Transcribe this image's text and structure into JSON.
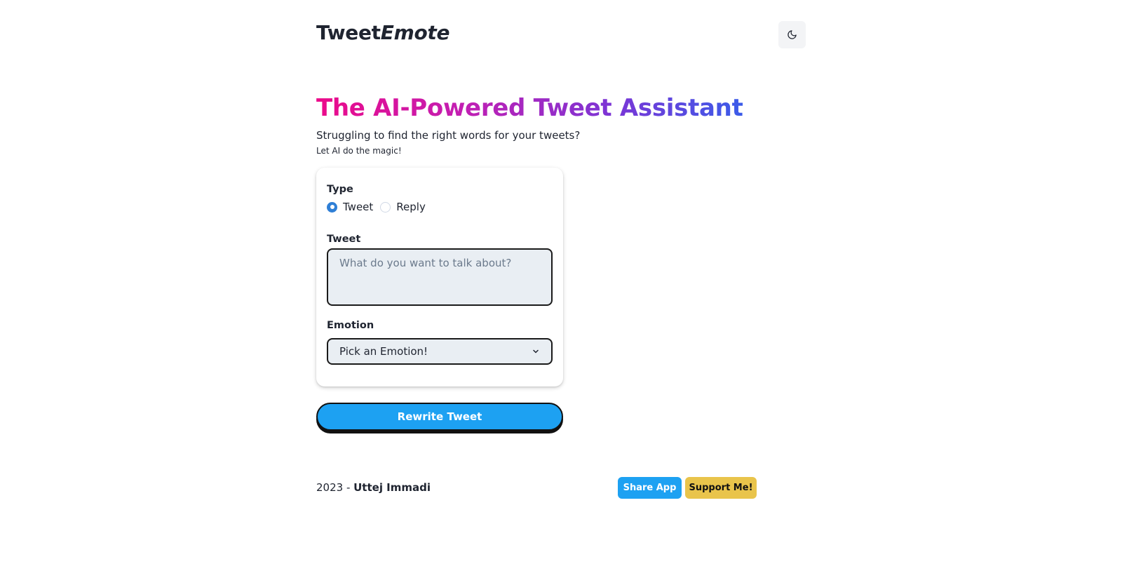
{
  "header": {
    "title_plain": "Tweet",
    "title_emphasis": "Emote",
    "theme_toggle_icon": "moon-icon"
  },
  "hero": {
    "headline": "The AI-Powered Tweet Assistant",
    "subtitle": "Struggling to find the right words for your tweets?",
    "tagline": "Let AI do the magic!",
    "gradient_colors": [
      "#ec0a8a",
      "#c11fb3",
      "#7a36d6",
      "#3b5ce9"
    ]
  },
  "form": {
    "type_label": "Type",
    "type_options": [
      {
        "label": "Tweet",
        "selected": true
      },
      {
        "label": "Reply",
        "selected": false
      }
    ],
    "tweet_label": "Tweet",
    "tweet_placeholder": "What do you want to talk about?",
    "tweet_value": "",
    "emotion_label": "Emotion",
    "emotion_selected": "Pick an Emotion!"
  },
  "actions": {
    "rewrite_label": "Rewrite Tweet",
    "accent_color": "#1da1f2"
  },
  "footer": {
    "year": "2023 - ",
    "author": "Uttej Immadi",
    "share_label": "Share App",
    "support_label": "Support Me!",
    "support_color": "#e9c44b"
  }
}
